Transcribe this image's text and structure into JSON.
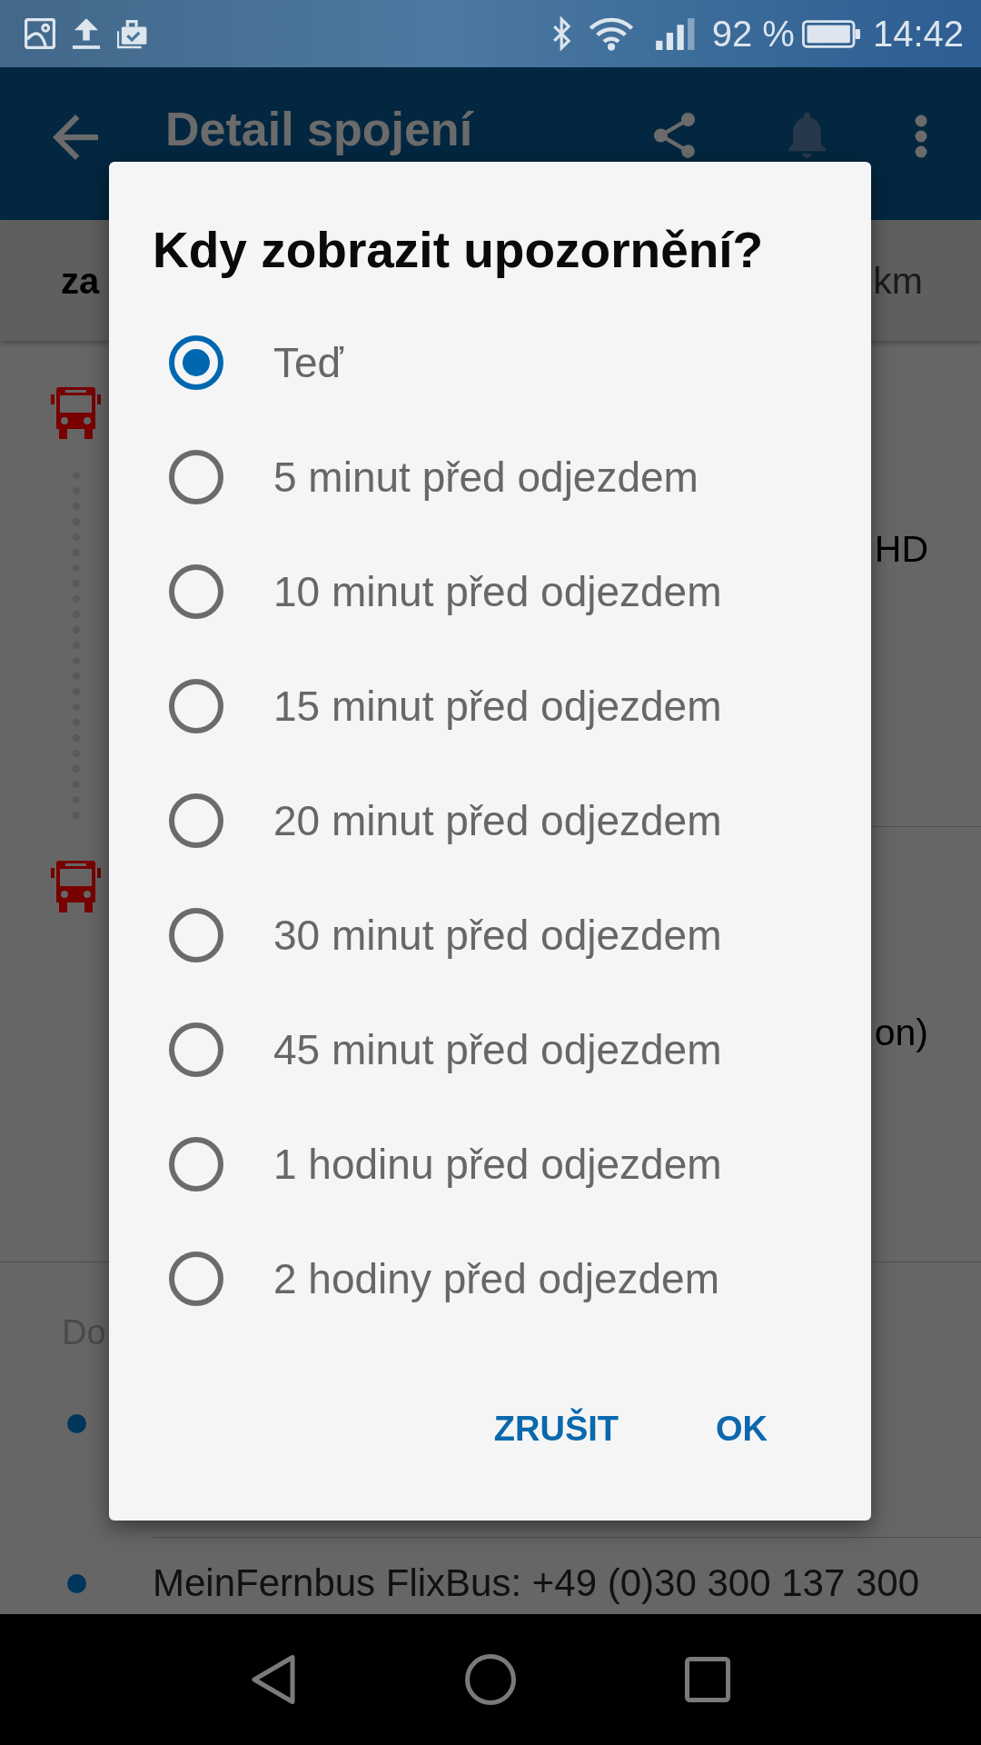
{
  "status_bar": {
    "battery": "92 %",
    "time": "14:42"
  },
  "app_bar": {
    "title": "Detail spojení"
  },
  "summary": {
    "left": "za",
    "right": "km"
  },
  "connection": {
    "rows": [
      {
        "text": "HD"
      },
      {
        "text": "on)"
      }
    ]
  },
  "operator": {
    "label": "Do",
    "contacts": [
      {
        "bullet": true
      },
      {
        "bullet": true,
        "text": "MeinFernbus FlixBus: +49 (0)30 300 137 300"
      }
    ]
  },
  "dialog": {
    "title": "Kdy zobrazit upozornění?",
    "options": [
      {
        "label": "Teď",
        "selected": true
      },
      {
        "label": "5 minut před odjezdem",
        "selected": false
      },
      {
        "label": "10 minut před odjezdem",
        "selected": false
      },
      {
        "label": "15 minut před odjezdem",
        "selected": false
      },
      {
        "label": "20 minut před odjezdem",
        "selected": false
      },
      {
        "label": "30 minut před odjezdem",
        "selected": false
      },
      {
        "label": "45 minut před odjezdem",
        "selected": false
      },
      {
        "label": "1 hodinu před odjezdem",
        "selected": false
      },
      {
        "label": "2 hodiny před odjezdem",
        "selected": false
      }
    ],
    "buttons": [
      "ZRUŠIT",
      "OK"
    ]
  }
}
